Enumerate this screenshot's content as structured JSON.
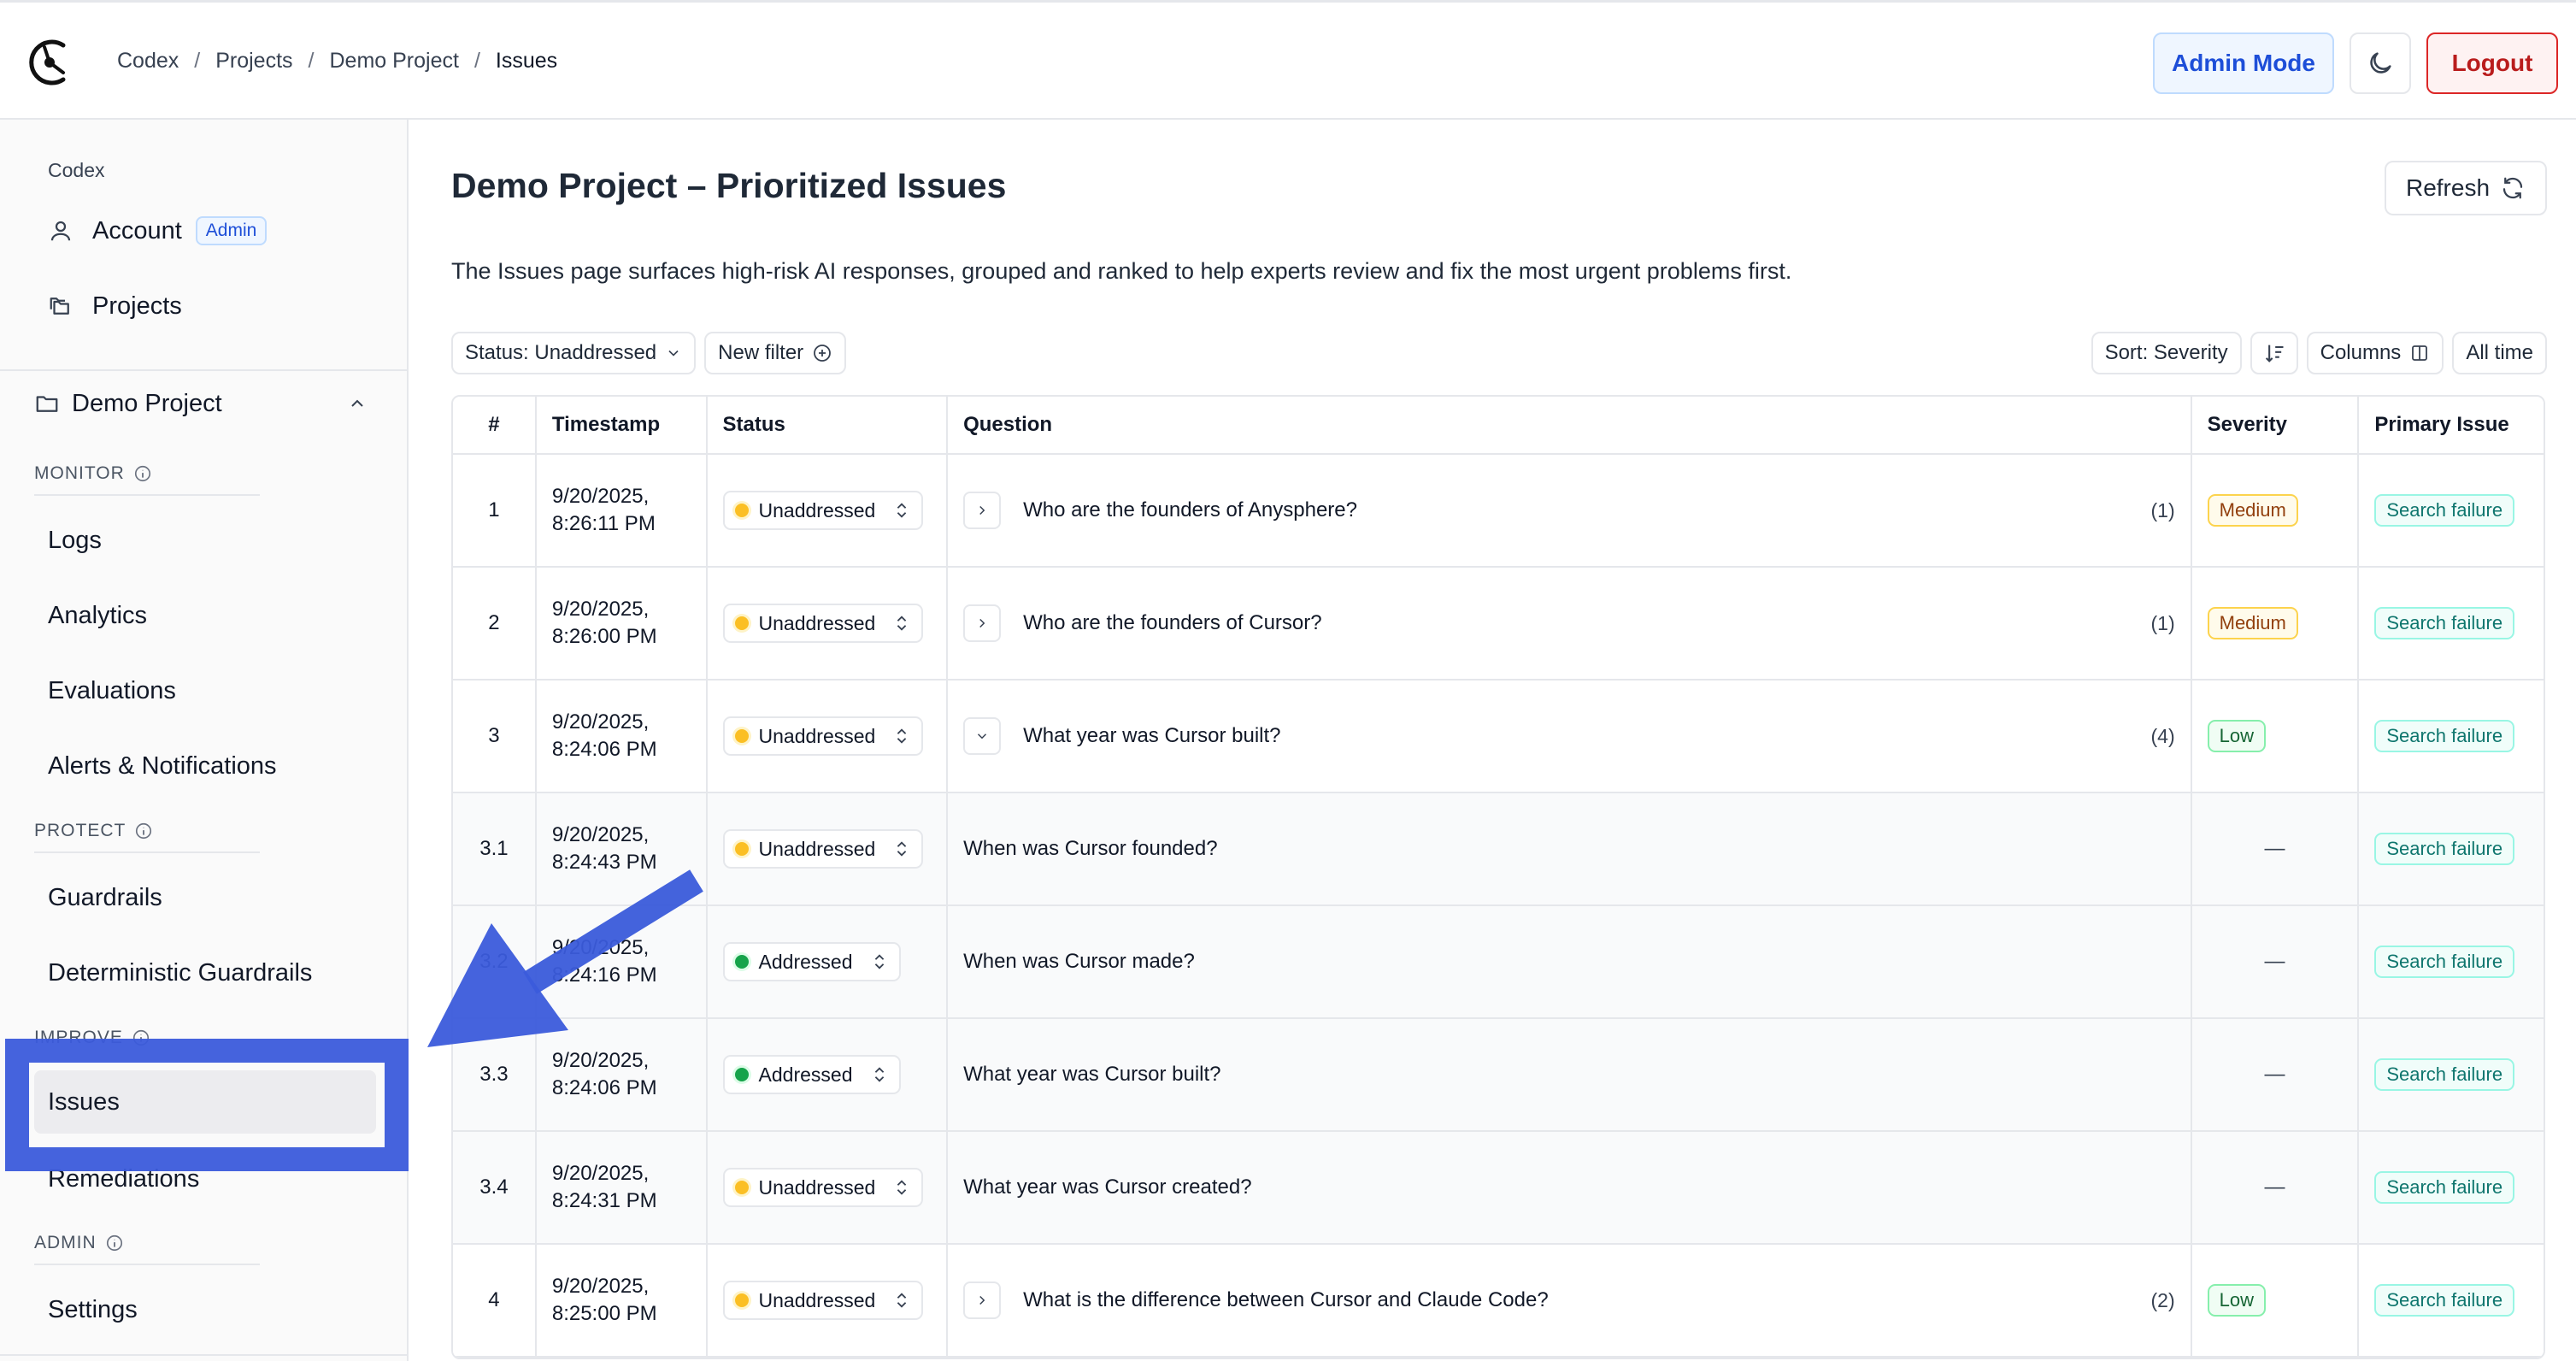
{
  "breadcrumb": [
    "Codex",
    "Projects",
    "Demo Project",
    "Issues"
  ],
  "header": {
    "admin_mode_label": "Admin Mode",
    "logout_label": "Logout"
  },
  "sidebar": {
    "org_label": "Codex",
    "account_label": "Account",
    "account_badge": "Admin",
    "projects_label": "Projects",
    "project_name": "Demo Project",
    "monitor_label": "MONITOR",
    "monitor_items": [
      "Logs",
      "Analytics",
      "Evaluations",
      "Alerts & Notifications"
    ],
    "protect_label": "PROTECT",
    "protect_items": [
      "Guardrails",
      "Deterministic Guardrails"
    ],
    "improve_label": "IMPROVE",
    "improve_items": [
      "Issues",
      "Remediations"
    ],
    "admin_label": "ADMIN",
    "admin_items": [
      "Settings"
    ],
    "active_item": "Issues"
  },
  "page": {
    "title": "Demo Project – Prioritized Issues",
    "refresh_label": "Refresh",
    "description": "The Issues page surfaces high-risk AI responses, grouped and ranked to help experts review and fix the most urgent problems first."
  },
  "filters": {
    "status_filter": "Status: Unaddressed",
    "new_filter": "New filter",
    "sort": "Sort: Severity",
    "columns": "Columns",
    "time_range": "All time"
  },
  "table": {
    "headers": [
      "#",
      "Timestamp",
      "Status",
      "Question",
      "Severity",
      "Primary Issue"
    ],
    "rows": [
      {
        "num": "1",
        "ts1": "9/20/2025,",
        "ts2": "8:26:11 PM",
        "status": "Unaddressed",
        "question": "Who are the founders of Anysphere?",
        "count": "(1)",
        "severity": "Medium",
        "issue": "Search failure"
      },
      {
        "num": "2",
        "ts1": "9/20/2025,",
        "ts2": "8:26:00 PM",
        "status": "Unaddressed",
        "question": "Who are the founders of Cursor?",
        "count": "(1)",
        "severity": "Medium",
        "issue": "Search failure"
      },
      {
        "num": "3",
        "ts1": "9/20/2025,",
        "ts2": "8:24:06 PM",
        "status": "Unaddressed",
        "question": "What year was Cursor built?",
        "count": "(4)",
        "severity": "Low",
        "issue": "Search failure"
      },
      {
        "num": "3.1",
        "ts1": "9/20/2025,",
        "ts2": "8:24:43 PM",
        "status": "Unaddressed",
        "question": "When was Cursor founded?",
        "count": "",
        "severity": "—",
        "issue": "Search failure"
      },
      {
        "num": "3.2",
        "ts1": "9/20/2025,",
        "ts2": "8:24:16 PM",
        "status": "Addressed",
        "question": "When was Cursor made?",
        "count": "",
        "severity": "—",
        "issue": "Search failure"
      },
      {
        "num": "3.3",
        "ts1": "9/20/2025,",
        "ts2": "8:24:06 PM",
        "status": "Addressed",
        "question": "What year was Cursor built?",
        "count": "",
        "severity": "—",
        "issue": "Search failure"
      },
      {
        "num": "3.4",
        "ts1": "9/20/2025,",
        "ts2": "8:24:31 PM",
        "status": "Unaddressed",
        "question": "What year was Cursor created?",
        "count": "",
        "severity": "—",
        "issue": "Search failure"
      },
      {
        "num": "4",
        "ts1": "9/20/2025,",
        "ts2": "8:25:00 PM",
        "status": "Unaddressed",
        "question": "What is the difference between Cursor and Claude Code?",
        "count": "(2)",
        "severity": "Low",
        "issue": "Search failure"
      }
    ]
  },
  "colors": {
    "accent": "#3b5bdb",
    "admin_blue": "#1d4ed8",
    "logout_red": "#b91c1c"
  }
}
